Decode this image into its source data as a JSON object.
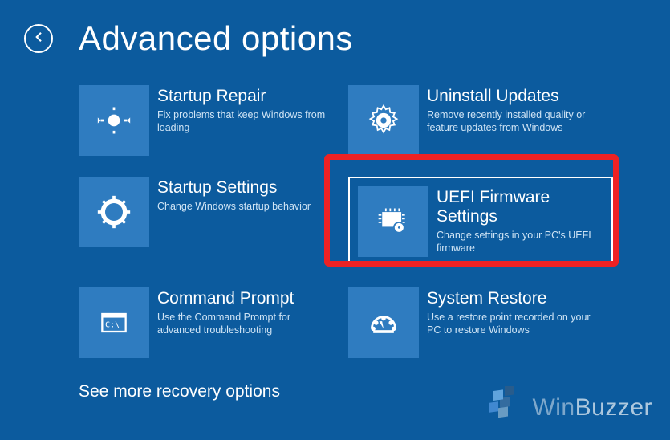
{
  "header": {
    "title": "Advanced options"
  },
  "tiles": {
    "startup_repair": {
      "title": "Startup Repair",
      "desc": "Fix problems that keep Windows from loading"
    },
    "uninstall_updates": {
      "title": "Uninstall Updates",
      "desc": "Remove recently installed quality or feature updates from Windows"
    },
    "startup_settings": {
      "title": "Startup Settings",
      "desc": "Change Windows startup behavior"
    },
    "uefi": {
      "title": "UEFI Firmware Settings",
      "desc": "Change settings in your PC's UEFI firmware"
    },
    "command_prompt": {
      "title": "Command Prompt",
      "desc": "Use the Command Prompt for advanced troubleshooting"
    },
    "system_restore": {
      "title": "System Restore",
      "desc": "Use a restore point recorded on your PC to restore Windows"
    }
  },
  "more_link": "See more recovery options",
  "watermark": "WinBuzzer",
  "colors": {
    "background": "#0c5b9e",
    "tile": "#2f7cc0",
    "highlight": "#ed2224"
  }
}
